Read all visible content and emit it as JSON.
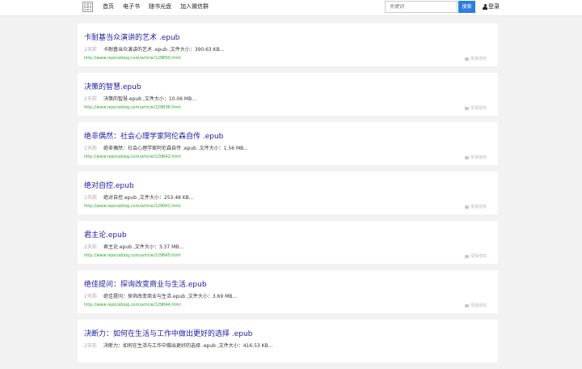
{
  "nav": {
    "logo_icon": "grid-icon",
    "items": [
      "首页",
      "电子书",
      "随书光盘",
      "加入微信群"
    ]
  },
  "search": {
    "placeholder": "关键词",
    "button_label": "搜索"
  },
  "login": {
    "label": "登录",
    "icon": "user-icon"
  },
  "results": [
    {
      "title": "卡耐基当众演讲的艺术 .epub",
      "time": "2天前",
      "desc": "卡耐基当众演讲的艺术 .epub ,文件大小：390.63 KB...",
      "url": "http://www.rejoiceblog.com/article/129850.html",
      "report": "举报侵权"
    },
    {
      "title": "决策的智慧.epub",
      "time": "2天前",
      "desc": "决策的智慧.epub ,文件大小：10.06 MB...",
      "url": "http://www.rejoiceblog.com/article/129836.html",
      "report": "举报侵权"
    },
    {
      "title": "绝非偶然：社会心理学家阿伦森自传 .epub",
      "time": "2天前",
      "desc": "绝非偶然：社会心理学家阿伦森自传 .epub ,文件大小：1.56 MB...",
      "url": "http://www.rejoiceblog.com/article/129842.html",
      "report": "举报侵权"
    },
    {
      "title": "绝对自控.epub",
      "time": "2天前",
      "desc": "绝对自控.epub ,文件大小：253.48 KB...",
      "url": "http://www.rejoiceblog.com/article/129841.html",
      "report": "举报侵权"
    },
    {
      "title": "君主论.epub",
      "time": "2天前",
      "desc": "君主论.epub ,文件大小：3.37 MB...",
      "url": "http://www.rejoiceblog.com/article/129845.html",
      "report": "举报侵权"
    },
    {
      "title": "绝佳提问：探询改变商业与生活.epub",
      "time": "2天前",
      "desc": "绝佳提问：探询改变商业与生活.epub ,文件大小：3.69 MB...",
      "url": "http://www.rejoiceblog.com/article/129844.html",
      "report": "举报侵权"
    },
    {
      "title": "决断力：如何在生活与工作中做出更好的选择 .epub",
      "time": "2天前",
      "desc": "决断力：如何在生活与工作中做出更好的选择 .epub ,文件大小：416.53 KB...",
      "url": "",
      "report": ""
    }
  ]
}
